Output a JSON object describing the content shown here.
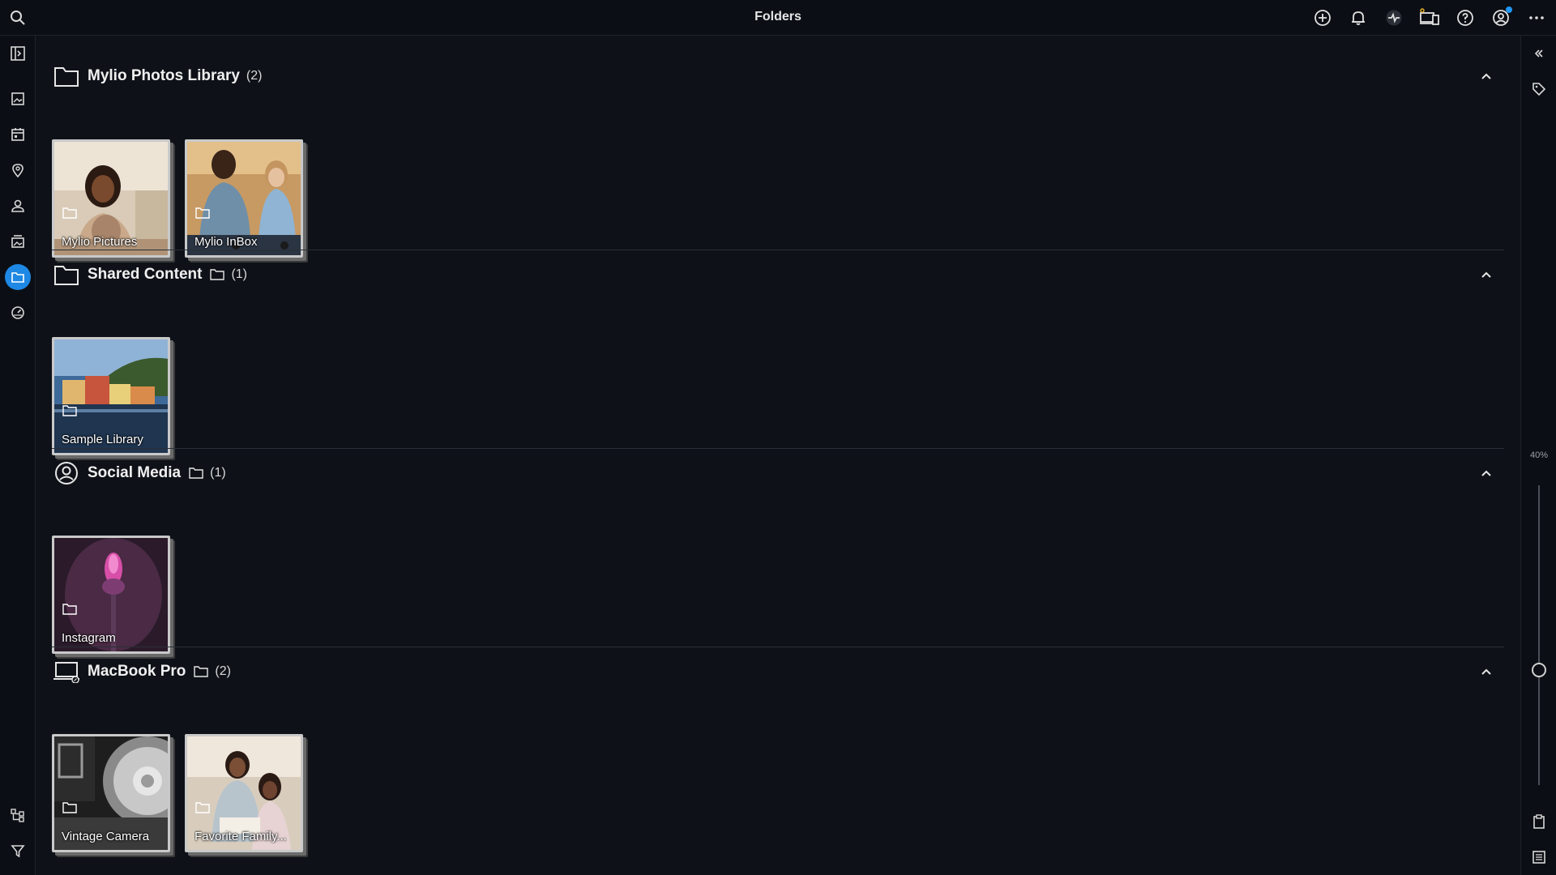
{
  "window": {
    "title": "Folders"
  },
  "topbar": {
    "search_icon": "search-icon",
    "actions": [
      "add-icon",
      "bell-icon",
      "activity-icon",
      "devices-icon",
      "help-icon",
      "account-icon",
      "more-icon"
    ]
  },
  "leftrail": {
    "items": [
      "sidebar-toggle-icon",
      "photos-icon",
      "calendar-icon",
      "map-pin-icon",
      "people-icon",
      "albums-icon",
      "folder-icon",
      "dashboard-icon"
    ],
    "active": "folder-icon",
    "bottom": [
      "hierarchy-icon",
      "filter-icon"
    ]
  },
  "rightrail": {
    "zoom_label": "40%",
    "zoom_value": 0.4
  },
  "sections": [
    {
      "name": "Mylio Photos Library",
      "count": "(2)",
      "icon": "folder-icon",
      "tiles": [
        {
          "label": "Mylio Pictures"
        },
        {
          "label": "Mylio InBox"
        }
      ]
    },
    {
      "name": "Shared Content",
      "count": "(1)",
      "icon": "folder-icon",
      "tiles": [
        {
          "label": "Sample Library"
        }
      ]
    },
    {
      "name": "Social Media",
      "count": "(1)",
      "icon": "social-profile-icon",
      "tiles": [
        {
          "label": "Instagram"
        }
      ]
    },
    {
      "name": "MacBook Pro",
      "count": "(2)",
      "icon": "laptop-icon",
      "tiles": [
        {
          "label": "Vintage Camera"
        },
        {
          "label": "Favorite Family..."
        }
      ]
    }
  ],
  "colors": {
    "accent": "#1e88e5",
    "background": "#0e1218",
    "badge": "#2196f3"
  }
}
